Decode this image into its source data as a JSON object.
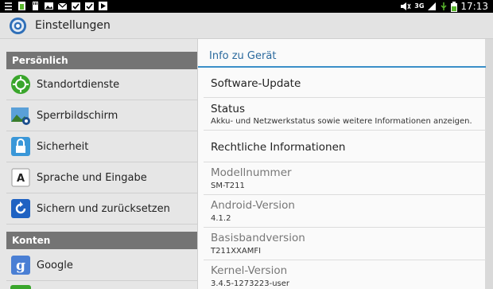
{
  "statusbar": {
    "time": "17:13",
    "network": "3G",
    "notification_icons": [
      "menu-icon",
      "battery-notification-icon",
      "sd-card-icon",
      "image-icon",
      "gmail-icon",
      "calendar-check-icon",
      "calendar-check-icon",
      "play-store-icon"
    ],
    "system_icons": [
      "mute-icon",
      "signal-icon",
      "usb-icon",
      "battery-icon"
    ]
  },
  "actionbar": {
    "title": "Einstellungen",
    "icon": "settings-gear-icon"
  },
  "sidebar": {
    "sections": [
      {
        "header": "Persönlich",
        "items": [
          {
            "label": "Standortdienste",
            "icon": "location-icon"
          },
          {
            "label": "Sperrbildschirm",
            "icon": "lockscreen-icon"
          },
          {
            "label": "Sicherheit",
            "icon": "lock-icon"
          },
          {
            "label": "Sprache und Eingabe",
            "icon": "keyboard-a-icon"
          },
          {
            "label": "Sichern und zurücksetzen",
            "icon": "backup-icon"
          }
        ]
      },
      {
        "header": "Konten",
        "items": [
          {
            "label": "Google",
            "icon": "google-icon"
          }
        ]
      }
    ]
  },
  "detail": {
    "title": "Info zu Gerät",
    "items": [
      {
        "title": "Software-Update",
        "subtitle": ""
      },
      {
        "title": "Status",
        "subtitle": "Akku- und Netzwerkstatus sowie weitere Informationen anzeigen."
      },
      {
        "title": "Rechtliche Informationen",
        "subtitle": ""
      },
      {
        "title": "Modellnummer",
        "subtitle": "SM-T211"
      },
      {
        "title": "Android-Version",
        "subtitle": "4.1.2"
      },
      {
        "title": "Basisbandversion",
        "subtitle": "T211XXAMFI"
      },
      {
        "title": "Kernel-Version",
        "subtitle": "3.4.5-1273223-user"
      }
    ]
  },
  "colors": {
    "accent": "#3a8fc8",
    "section_header": "#747474",
    "statusbar": "#000000"
  }
}
